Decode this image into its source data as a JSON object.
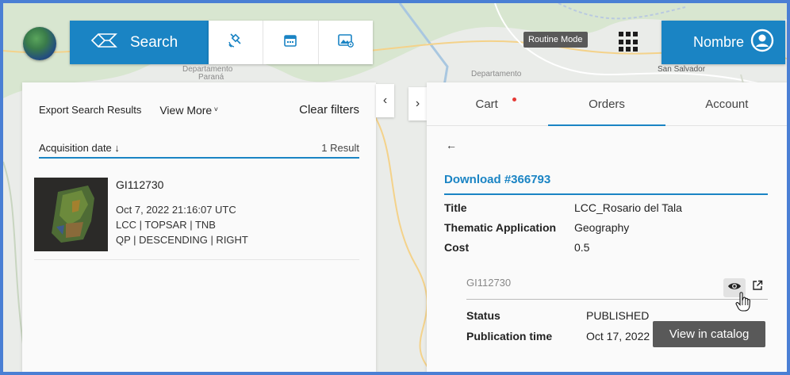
{
  "header": {
    "search_label": "Search",
    "routine_mode": "Routine Mode",
    "user_name": "Nombre"
  },
  "map_labels": {
    "departamento_left": "Departamento",
    "parana": "Paraná",
    "departamento_right": "Departamento",
    "san_salvador": "San Salvador"
  },
  "left_panel": {
    "export_label": "Export Search Results",
    "view_more_label": "View More",
    "clear_filters_label": "Clear filters",
    "sort_label": "Acquisition date ↓",
    "result_count": "1 Result",
    "results": [
      {
        "id": "GI112730",
        "date": "Oct 7, 2022 21:16:07 UTC",
        "line1": "LCC | TOPSAR | TNB",
        "line2": "QP | DESCENDING | RIGHT"
      }
    ]
  },
  "right_panel": {
    "tabs": [
      "Cart",
      "Orders",
      "Account"
    ],
    "active_tab": "Orders",
    "back_arrow": "←",
    "download_title": "Download #366793",
    "details": [
      {
        "key": "Title",
        "value": "LCC_Rosario del Tala"
      },
      {
        "key": "Thematic Application",
        "value": "Geography"
      },
      {
        "key": "Cost",
        "value": "0.5"
      }
    ],
    "item_id": "GI112730",
    "item_details": [
      {
        "key": "Status",
        "value": "PUBLISHED"
      },
      {
        "key": "Publication time",
        "value": "Oct 17, 2022"
      }
    ],
    "tooltip": "View in catalog"
  },
  "colors": {
    "accent": "#1a84c4",
    "frame": "#4a7fd4",
    "tooltip_bg": "#595959",
    "badge": "#e53935"
  },
  "icons": [
    "globe-icon",
    "search-icon",
    "satellite-icon",
    "calendar-icon",
    "image-settings-icon",
    "apps-grid-icon",
    "user-account-icon",
    "eye-icon",
    "external-link-icon",
    "hand-cursor-icon"
  ]
}
